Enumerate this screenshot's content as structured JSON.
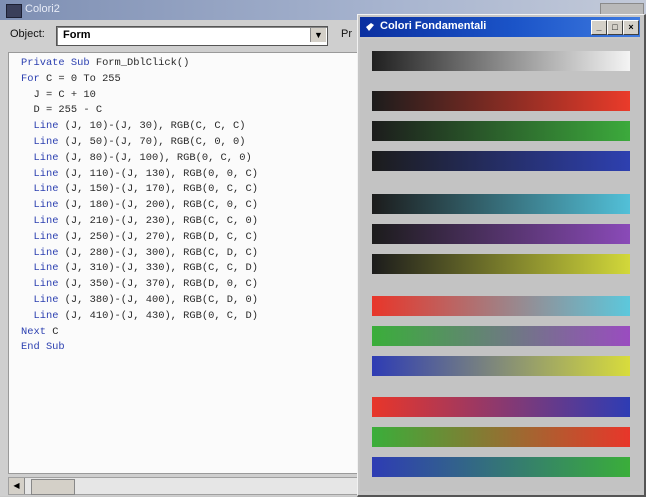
{
  "code_window": {
    "title": "Colori2",
    "object_label": "Object:",
    "object_value": "Form",
    "proc_label": "Pr",
    "lines": [
      "Private Sub Form_DblClick()",
      "For C = 0 To 255",
      "  J = C + 10",
      "  D = 255 - C",
      "  Line (J, 10)-(J, 30), RGB(C, C, C)",
      "  Line (J, 50)-(J, 70), RGB(C, 0, 0)",
      "  Line (J, 80)-(J, 100), RGB(0, C, 0)",
      "  Line (J, 110)-(J, 130), RGB(0, 0, C)",
      "  Line (J, 150)-(J, 170), RGB(0, C, C)",
      "  Line (J, 180)-(J, 200), RGB(C, 0, C)",
      "  Line (J, 210)-(J, 230), RGB(C, C, 0)",
      "  Line (J, 250)-(J, 270), RGB(D, C, C)",
      "  Line (J, 280)-(J, 300), RGB(C, D, C)",
      "  Line (J, 310)-(J, 330), RGB(C, C, D)",
      "  Line (J, 350)-(J, 370), RGB(D, 0, C)",
      "  Line (J, 380)-(J, 400), RGB(C, D, 0)",
      "  Line (J, 410)-(J, 430), RGB(0, C, D)",
      "Next C",
      "End Sub"
    ]
  },
  "palette_window": {
    "title": "Colori Fondamentali",
    "buttons": {
      "minimize": "_",
      "maximize": "□",
      "close": "×"
    },
    "gradients": [
      {
        "from": "#202020",
        "to": "#f4f4f4"
      },
      {
        "from": "#1c1c1c",
        "to": "#ea3b2a"
      },
      {
        "from": "#1c1c1c",
        "to": "#3caa3c"
      },
      {
        "from": "#1c1c1c",
        "to": "#2e40b0"
      },
      {
        "from": "#1c1c1c",
        "to": "#52c0d8"
      },
      {
        "from": "#1c1c1c",
        "to": "#8a4ab8"
      },
      {
        "from": "#1c1c1c",
        "to": "#d2d83a"
      },
      {
        "from": "#e8362a",
        "to": "#5cc8dc"
      },
      {
        "from": "#3aae3a",
        "to": "#9a4cc0"
      },
      {
        "from": "#2e3cb4",
        "to": "#d8dc3c"
      },
      {
        "from": "#e8362a",
        "to": "#2e3cb4"
      },
      {
        "from": "#3aae3a",
        "to": "#e8362a"
      },
      {
        "from": "#2e3cb4",
        "to": "#3aae3a"
      }
    ]
  }
}
